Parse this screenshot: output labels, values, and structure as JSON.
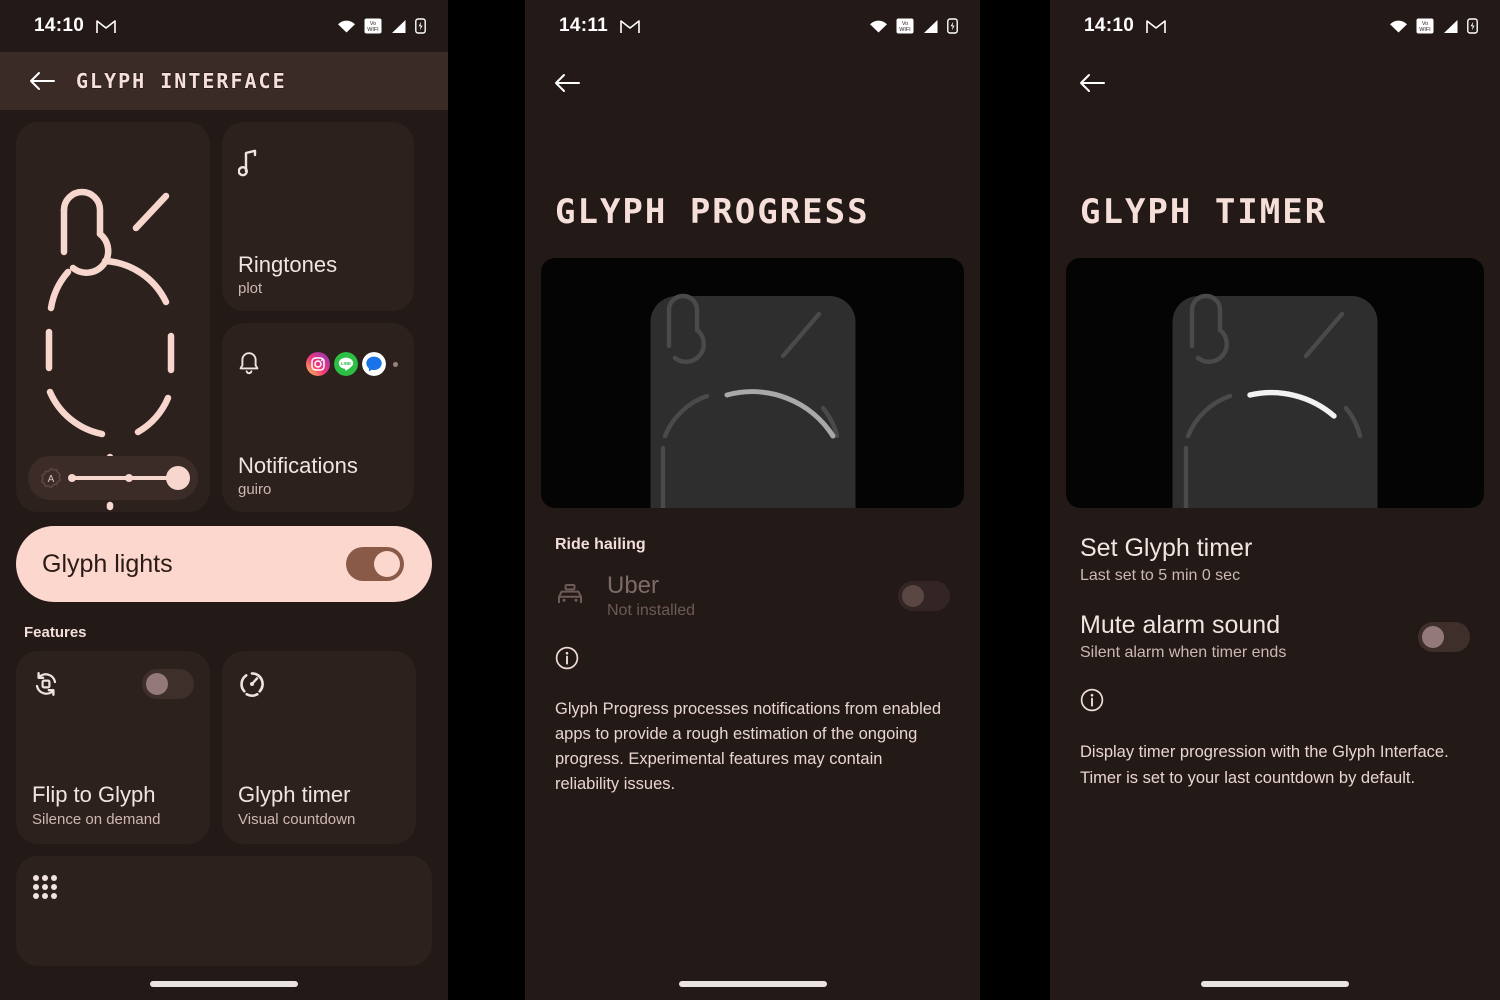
{
  "colors": {
    "background": "#231917",
    "card": "#2d211e",
    "accent_pink": "#fbd7cd",
    "accent_brown": "#8a5a48",
    "text_primary": "#f1e4e1",
    "text_secondary": "#cdb7b2",
    "preview_black": "#050404"
  },
  "panel_glyph_interface": {
    "statusbar": {
      "time": "14:10",
      "mail_icon": "gmail-icon",
      "wifi_icon": "wifi-icon",
      "vowifi_label": "Vo WIFI",
      "signal_icon": "signal-icon",
      "battery_icon": "battery-icon"
    },
    "appbar": {
      "back_icon": "back-arrow-icon",
      "title": "GLYPH INTERFACE"
    },
    "preview": {
      "name": "glyph-pattern-preview",
      "brightness_icon": "auto-brightness-icon",
      "brightness_value": "100"
    },
    "ringtones_card": {
      "icon": "music-note-icon",
      "title": "Ringtones",
      "subtitle": "plot"
    },
    "notifications_card": {
      "icon": "bell-icon",
      "title": "Notifications",
      "subtitle": "guiro",
      "apps": [
        "instagram-icon",
        "line-icon",
        "messages-icon"
      ],
      "more_indicator": "more-dot"
    },
    "glyph_lights": {
      "label": "Glyph lights",
      "enabled": true
    },
    "features_label": "Features",
    "features": [
      {
        "icon": "flip-rotate-icon",
        "title": "Flip to Glyph",
        "subtitle": "Silence on demand",
        "toggle": false
      },
      {
        "icon": "timer-circle-icon",
        "title": "Glyph timer",
        "subtitle": "Visual countdown"
      }
    ],
    "bottom_card": {
      "icon": "apps-grid-icon"
    }
  },
  "panel_glyph_progress": {
    "statusbar": {
      "time": "14:11",
      "mail_icon": "gmail-icon",
      "wifi_icon": "wifi-icon",
      "vowifi_label": "Vo WIFI",
      "signal_icon": "signal-icon",
      "battery_icon": "battery-icon"
    },
    "back_icon": "back-arrow-icon",
    "title": "GLYPH PROGRESS",
    "preview": "glyph-progress-preview",
    "section_label": "Ride hailing",
    "rows": [
      {
        "icon": "taxi-icon",
        "title": "Uber",
        "subtitle": "Not installed",
        "enabled": false,
        "toggle": false
      }
    ],
    "info_icon": "info-icon",
    "description": "Glyph Progress processes notifications from enabled apps to provide a rough estimation of the ongoing progress. Experimental features may contain reliability issues."
  },
  "panel_glyph_timer": {
    "statusbar": {
      "time": "14:10",
      "mail_icon": "gmail-icon",
      "wifi_icon": "wifi-icon",
      "vowifi_label": "Vo WIFI",
      "signal_icon": "signal-icon",
      "battery_icon": "battery-icon"
    },
    "back_icon": "back-arrow-icon",
    "title": "GLYPH TIMER",
    "preview": "glyph-timer-preview",
    "rows": [
      {
        "title": "Set Glyph timer",
        "subtitle": "Last set to 5 min 0 sec"
      },
      {
        "title": "Mute alarm sound",
        "subtitle": "Silent alarm when timer ends",
        "toggle": false
      }
    ],
    "info_icon": "info-icon",
    "description": "Display timer progression with the Glyph Interface. Timer is set to your last countdown by default."
  }
}
